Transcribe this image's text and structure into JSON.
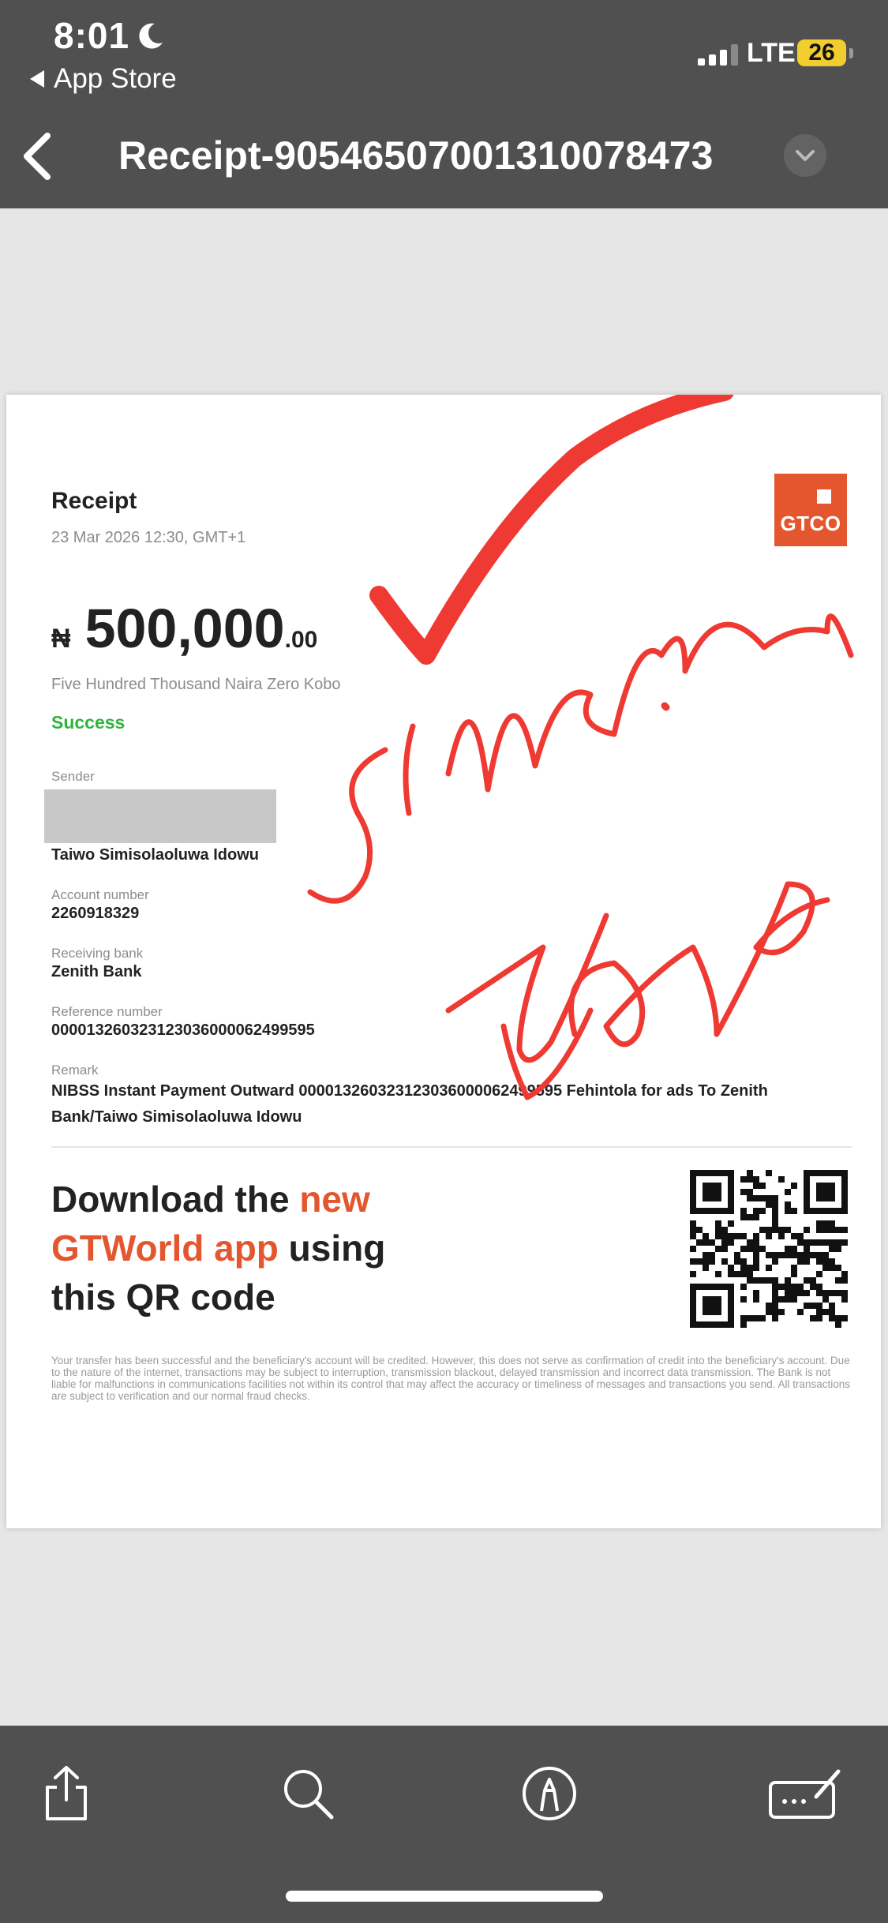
{
  "status_bar": {
    "time": "8:01",
    "back_app_label": "App Store",
    "network": "LTE",
    "battery": "26",
    "battery_color": "#f2cd2e"
  },
  "nav": {
    "title": "Receipt-905465070013100784​73"
  },
  "receipt": {
    "heading": "Receipt",
    "datetime": "23 Mar 2026 12:30, GMT+1",
    "logo_text": "GTCO",
    "currency_symbol": "₦",
    "amount_main": "500,000",
    "amount_decimal": ".00",
    "amount_words": "Five Hundred Thousand Naira Zero Kobo",
    "status": "Success",
    "status_color": "#2fb53c",
    "sender_label": "Sender",
    "sender_name": "Taiwo Simisolaoluwa Idowu",
    "account_label": "Account number",
    "account_number": "2260918329",
    "bank_label": "Receiving bank",
    "bank_name": "Zenith Bank",
    "reference_label": "Reference number",
    "reference_number": "000013260323123036000062499595",
    "remark_label": "Remark",
    "remark_text": "NIBSS Instant Payment Outward 000013260323123036000062499595 Fehintola for ads To Zenith Bank/Taiwo Simisolaoluwa Idowu",
    "promo_part1": "Download the ",
    "promo_highlight1": "new",
    "promo_highlight2": "GTWorld app",
    "promo_part2": " using",
    "promo_part3": "this QR code",
    "brand_color": "#e4572e",
    "disclaimer": "Your transfer has been successful and the beneficiary's account will be credited. However, this does not serve as confirmation of credit into the beneficiary's account. Due to the nature of the internet, transactions may be subject to interruption, transmission blackout, delayed transmission and incorrect data transmission. The Bank is not liable for malfunctions in communications facilities not within its control that may affect the accuracy or timeliness of messages and transactions you send. All transactions are subject to verification and our normal fraud checks."
  },
  "annotation": {
    "ink_color": "#ef3a33"
  },
  "toolbar": {
    "icons": [
      "share-icon",
      "search-icon",
      "markup-icon",
      "signature-icon"
    ]
  }
}
